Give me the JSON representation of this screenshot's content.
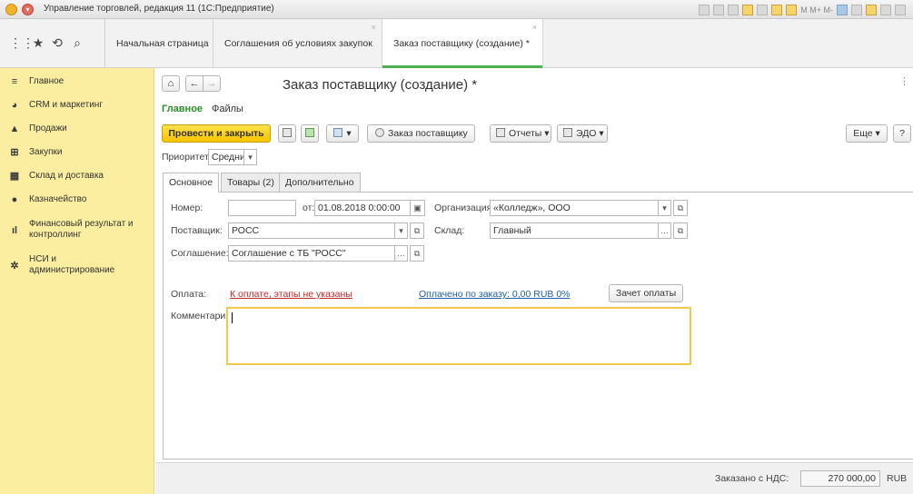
{
  "window": {
    "title": "Управление торговлей, редакция 11  (1С:Предприятие)",
    "toolbar_text": "M M+ M-"
  },
  "topbar": {
    "icons": [
      "grid-icon",
      "star-icon",
      "history-icon",
      "search-icon"
    ],
    "tabs": [
      {
        "label": "Начальная страница",
        "closable": false
      },
      {
        "label": "Соглашения об условиях закупок",
        "closable": true
      },
      {
        "label": "Заказ поставщику (создание) *",
        "closable": true,
        "active": true
      }
    ]
  },
  "sidebar": {
    "items": [
      {
        "label": "Главное",
        "icon": "menu-icon"
      },
      {
        "label": "CRM и маркетинг",
        "icon": "pie-chart-icon"
      },
      {
        "label": "Продажи",
        "icon": "bag-icon"
      },
      {
        "label": "Закупки",
        "icon": "cart-icon"
      },
      {
        "label": "Склад и доставка",
        "icon": "warehouse-icon"
      },
      {
        "label": "Казначейство",
        "icon": "coin-icon"
      },
      {
        "label": "Финансовый результат и контроллинг",
        "line1": "Финансовый результат и",
        "line2": "контроллинг",
        "icon": "bar-chart-icon"
      },
      {
        "label": "НСИ и администрирование",
        "line1": "НСИ и",
        "line2": "администрирование",
        "icon": "gear-icon"
      }
    ]
  },
  "form": {
    "title": "Заказ поставщику (создание) *",
    "subnav": {
      "main": "Главное",
      "files": "Файлы"
    },
    "toolbar": {
      "post_close": "Провести и закрыть",
      "order_supplier": "Заказ поставщику",
      "reports": "Отчеты",
      "edo": "ЭДО",
      "more": "Еще",
      "help": "?"
    },
    "priority": {
      "label": "Приоритет:",
      "value": "Средний"
    },
    "tabs": [
      "Основное",
      "Товары (2)",
      "Дополнительно"
    ],
    "fields": {
      "number_label": "Номер:",
      "number_value": "",
      "date_label": "от:",
      "date_value": "01.08.2018  0:00:00",
      "org_label": "Организация:",
      "org_value": "«Колледж», ООО",
      "supplier_label": "Поставщик:",
      "supplier_value": "РОСС",
      "warehouse_label": "Склад:",
      "warehouse_value": "Главный",
      "agreement_label": "Соглашение:",
      "agreement_value": "Соглашение с ТБ \"РОСС\"",
      "payment_label": "Оплата:",
      "payment_link": "К оплате, этапы не указаны",
      "paid_link": "Оплачено по заказу: 0,00 RUB  0%",
      "offset_button": "Зачет оплаты",
      "comment_label": "Комментарий:",
      "comment_value": ""
    },
    "footer": {
      "total_label": "Заказано с НДС:",
      "total_value": "270 000,00",
      "currency": "RUB"
    }
  },
  "colors": {
    "sidebar_bg": "#fbeea0",
    "primary_button": "#f5c400",
    "active_tab_accent": "#4caf50",
    "link_red": "#c62828",
    "link_blue": "#1f5fa8",
    "focus_border": "#f2c94c"
  }
}
